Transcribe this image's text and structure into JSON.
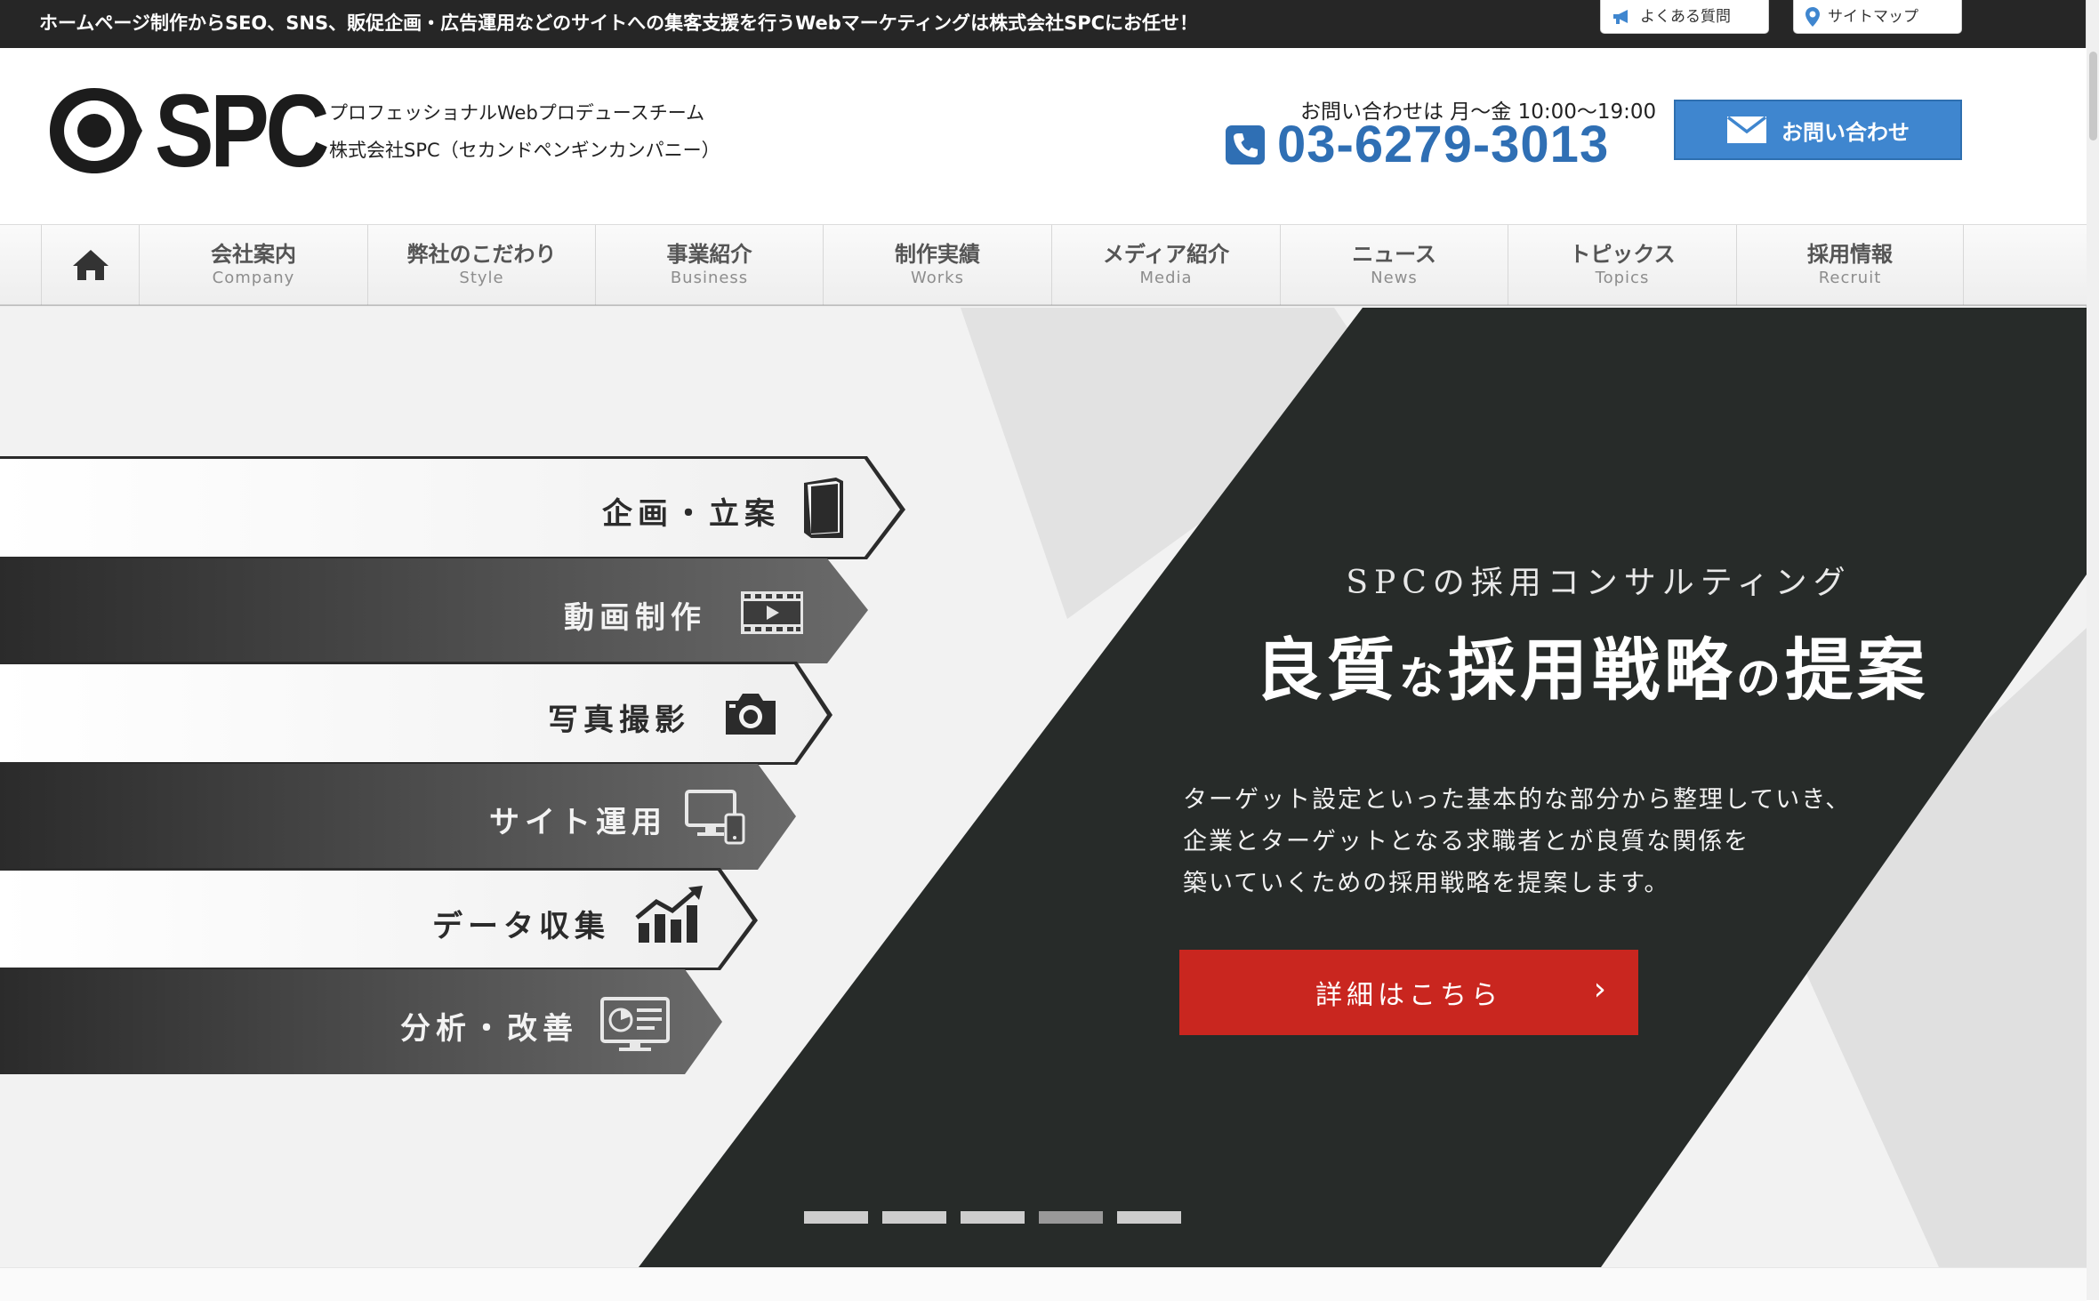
{
  "topbar": {
    "lead": "ホームページ制作からSEO、SNS、販促企画・広告運用などのサイトへの集客支援を行うWebマーケティングは株式会社SPCにお任せ！",
    "faq": "よくある質問",
    "sitemap": "サイトマップ"
  },
  "header": {
    "logo_text": "SPC",
    "tagline_1": "プロフェッショナルWebプロデュースチーム",
    "tagline_2": "株式会社SPC（セカンドペンギンカンパニー）",
    "hours": "お問い合わせは 月〜金 10:00〜19:00",
    "phone": "03-6279-3013",
    "contact_button": "お問い合わせ"
  },
  "nav": {
    "home_icon": "home-icon",
    "items": [
      {
        "jp": "会社案内",
        "en": "Company"
      },
      {
        "jp": "弊社のこだわり",
        "en": "Style"
      },
      {
        "jp": "事業紹介",
        "en": "Business"
      },
      {
        "jp": "制作実績",
        "en": "Works"
      },
      {
        "jp": "メディア紹介",
        "en": "Media"
      },
      {
        "jp": "ニュース",
        "en": "News"
      },
      {
        "jp": "トピックス",
        "en": "Topics"
      },
      {
        "jp": "採用情報",
        "en": "Recruit"
      }
    ]
  },
  "hero": {
    "steps": [
      {
        "label": "企画・立案",
        "icon": "book-icon"
      },
      {
        "label": "動画制作",
        "icon": "film-icon"
      },
      {
        "label": "写真撮影",
        "icon": "camera-icon"
      },
      {
        "label": "サイト運用",
        "icon": "devices-icon"
      },
      {
        "label": "データ収集",
        "icon": "growth-chart-icon"
      },
      {
        "label": "分析・改善",
        "icon": "analytics-screen-icon"
      }
    ],
    "subtitle": "SPCの採用コンサルティング",
    "title_part1": "良質",
    "title_part2": "な",
    "title_part3": "採用戦略",
    "title_part4": "の",
    "title_part5": "提案",
    "desc_1": "ターゲット設定といった基本的な部分から整理していき、",
    "desc_2": "企業とターゲットとなる求職者とが良質な関係を",
    "desc_3": "築いていくための採用戦略を提案します。",
    "button": "詳細はこちら",
    "button_chevron": "›",
    "slides_total": 5,
    "slide_active": 4
  },
  "colors": {
    "accent_blue": "#3f86cf",
    "phone_blue": "#2f6fb4",
    "cta_red": "#c9261f",
    "hero_dark": "#272b29"
  }
}
